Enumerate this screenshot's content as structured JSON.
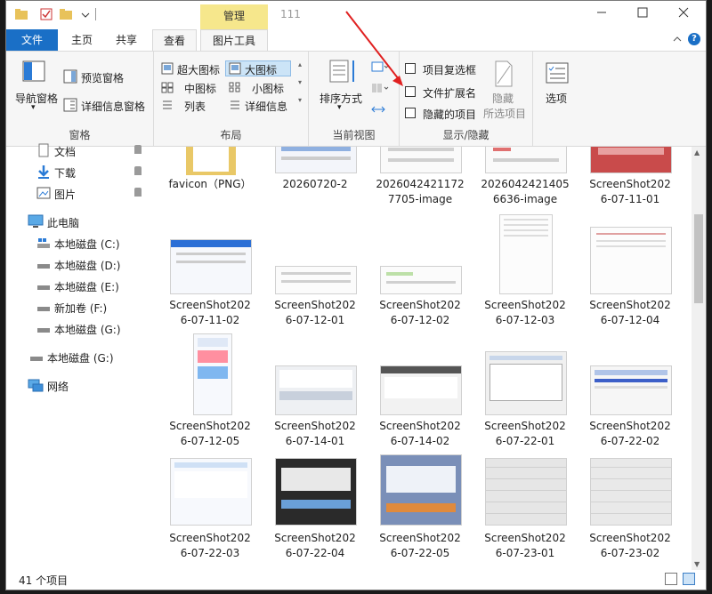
{
  "title": {
    "context_tab": "管理",
    "window_title": "111"
  },
  "tabs": {
    "file": "文件",
    "home": "主页",
    "share": "共享",
    "view": "查看",
    "picture_tools": "图片工具"
  },
  "ribbon": {
    "panes": {
      "nav_pane": "导航窗格",
      "preview_pane": "预览窗格",
      "details_pane": "详细信息窗格",
      "label": "窗格"
    },
    "layout": {
      "extra_large": "超大图标",
      "large": "大图标",
      "medium": "中图标",
      "small": "小图标",
      "list": "列表",
      "details": "详细信息",
      "label": "布局"
    },
    "current_view": {
      "sort_by": "排序方式",
      "label": "当前视图"
    },
    "show_hide": {
      "item_checkboxes": "项目复选框",
      "file_extensions": "文件扩展名",
      "hidden_items": "隐藏的项目",
      "hide_selected": "隐藏",
      "hide_selected2": "所选项目",
      "label": "显示/隐藏"
    },
    "options": "选项"
  },
  "nav": {
    "documents": "文档",
    "downloads": "下载",
    "pictures": "图片",
    "this_pc": "此电脑",
    "drive_c": "本地磁盘 (C:)",
    "drive_d": "本地磁盘 (D:)",
    "drive_e": "本地磁盘 (E:)",
    "drive_f": "新加卷 (F:)",
    "drive_g": "本地磁盘 (G:)",
    "drive_g2": "本地磁盘 (G:)",
    "network": "网络"
  },
  "files": [
    {
      "l1": "favicon（PNG）",
      "l2": ""
    },
    {
      "l1": "20260720-2",
      "l2": ""
    },
    {
      "l1": "2026042421172",
      "l2": "7705-image"
    },
    {
      "l1": "2026042421405",
      "l2": "6636-image"
    },
    {
      "l1": "ScreenShot202",
      "l2": "6-07-11-01"
    },
    {
      "l1": "ScreenShot202",
      "l2": "6-07-11-02"
    },
    {
      "l1": "ScreenShot202",
      "l2": "6-07-12-01"
    },
    {
      "l1": "ScreenShot202",
      "l2": "6-07-12-02"
    },
    {
      "l1": "ScreenShot202",
      "l2": "6-07-12-03"
    },
    {
      "l1": "ScreenShot202",
      "l2": "6-07-12-04"
    },
    {
      "l1": "ScreenShot202",
      "l2": "6-07-12-05"
    },
    {
      "l1": "ScreenShot202",
      "l2": "6-07-14-01"
    },
    {
      "l1": "ScreenShot202",
      "l2": "6-07-14-02"
    },
    {
      "l1": "ScreenShot202",
      "l2": "6-07-22-01"
    },
    {
      "l1": "ScreenShot202",
      "l2": "6-07-22-02"
    },
    {
      "l1": "ScreenShot202",
      "l2": "6-07-22-03"
    },
    {
      "l1": "ScreenShot202",
      "l2": "6-07-22-04"
    },
    {
      "l1": "ScreenShot202",
      "l2": "6-07-22-05"
    },
    {
      "l1": "ScreenShot202",
      "l2": "6-07-23-01"
    },
    {
      "l1": "ScreenShot202",
      "l2": "6-07-23-02"
    }
  ],
  "status": {
    "count": "41 个项目"
  },
  "colors": {
    "accent": "#1a6fc6",
    "context_tab": "#f6e78c",
    "annotation_arrow": "#e02020"
  }
}
